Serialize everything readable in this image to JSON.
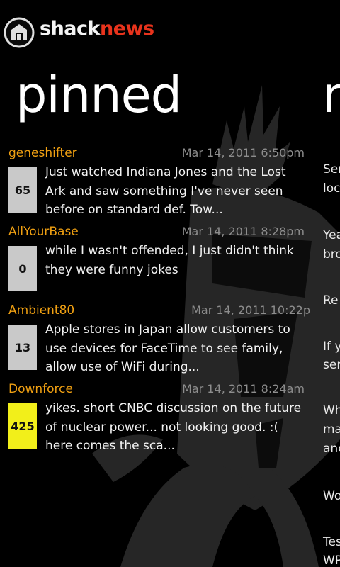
{
  "app": {
    "logo_part1": "shack",
    "logo_part2": "news",
    "brand_color": "#e8331c"
  },
  "panel": {
    "title": "pinned",
    "next_title_peek": "n"
  },
  "pinned_threads": [
    {
      "author": "geneshifter",
      "date": "Mar 14, 2011 6:50pm",
      "reply_count": "65",
      "preview": "Just watched Indiana Jones and the Lost Ark and saw something I've never seen before on standard def. Tow...",
      "highlight": false
    },
    {
      "author": "AllYourBase",
      "date": "Mar 14, 2011 8:28pm",
      "reply_count": "0",
      "preview": "while I wasn't offended, I just didn't think they were funny jokes",
      "highlight": false
    },
    {
      "author": "Ambient80",
      "date": "Mar 14, 2011 10:22p",
      "reply_count": "13",
      "preview": "Apple stores in Japan allow customers to use devices for FaceTime to see family, allow use of WiFi during...",
      "highlight": false
    },
    {
      "author": "Downforce",
      "date": "Mar 14, 2011 8:24am",
      "reply_count": "425",
      "preview": "yikes. short CNBC discussion on the future of nuclear power...  not looking good. :(   here comes the sca...",
      "highlight": true
    }
  ],
  "chatty_peek": [
    "Ser",
    "loc",
    "Yea",
    "bro",
    "Re",
    "If y",
    "ser",
    "Wh",
    "ma",
    "and",
    "Wo",
    "Tes",
    "WP"
  ],
  "colors": {
    "author": "#f0a012",
    "date": "#8d8d8d",
    "badge": "#c9c9c9",
    "badge_hot": "#f2ef1a"
  }
}
